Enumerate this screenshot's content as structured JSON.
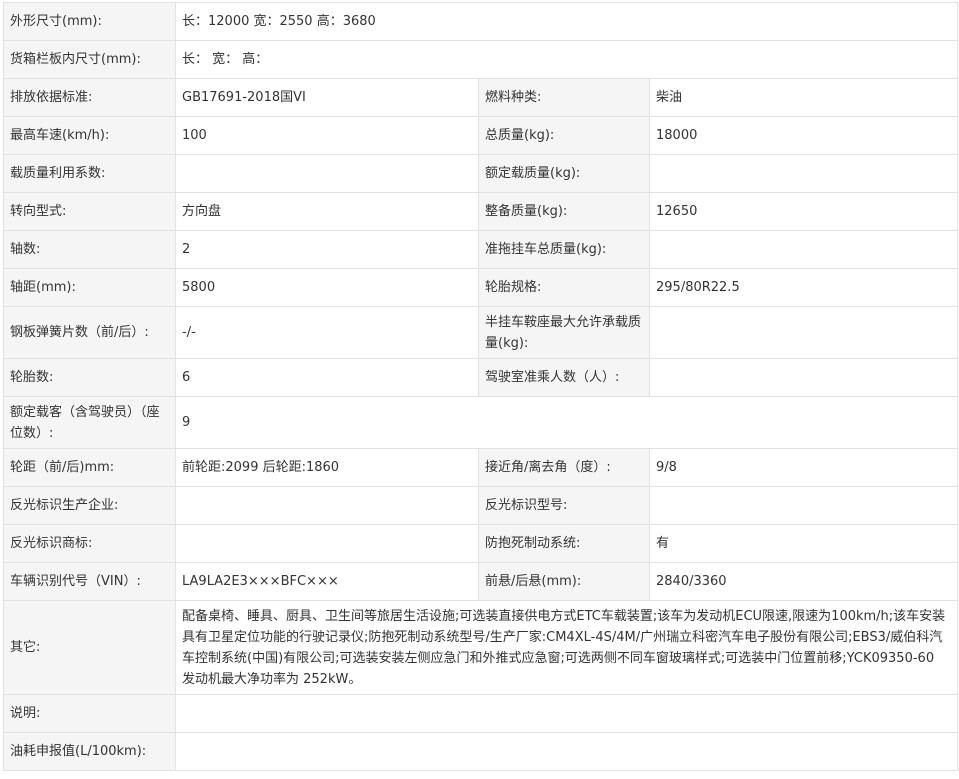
{
  "rows": {
    "dimensions": {
      "label": "外形尺寸(mm):",
      "value": "长：12000 宽：2550 高：3680"
    },
    "cargo_box": {
      "label": "货箱栏板内尺寸(mm):",
      "value": "长： 宽： 高："
    },
    "emission_standard": {
      "label": "排放依据标准:",
      "value": "GB17691-2018国VI"
    },
    "fuel_type": {
      "label": "燃料种类:",
      "value": "柴油"
    },
    "max_speed": {
      "label": "最高车速(km/h):",
      "value": "100"
    },
    "total_mass": {
      "label": "总质量(kg):",
      "value": "18000"
    },
    "load_utilization": {
      "label": "载质量利用系数:",
      "value": ""
    },
    "rated_load": {
      "label": "额定载质量(kg):",
      "value": ""
    },
    "steering": {
      "label": "转向型式:",
      "value": "方向盘"
    },
    "curb_mass": {
      "label": "整备质量(kg):",
      "value": "12650"
    },
    "axles": {
      "label": "轴数:",
      "value": "2"
    },
    "trailer_mass": {
      "label": "准拖挂车总质量(kg):",
      "value": ""
    },
    "wheelbase": {
      "label": "轴距(mm):",
      "value": "5800"
    },
    "tire_spec": {
      "label": "轮胎规格:",
      "value": "295/80R22.5"
    },
    "leaf_springs": {
      "label": "钢板弹簧片数（前/后）:",
      "value": "-/-"
    },
    "saddle_load": {
      "label": "半挂车鞍座最大允许承载质量(kg):",
      "value": ""
    },
    "tire_count": {
      "label": "轮胎数:",
      "value": "6"
    },
    "cab_passengers": {
      "label": "驾驶室准乘人数（人）:",
      "value": ""
    },
    "seats": {
      "label": "额定载客（含驾驶员）（座位数）:",
      "value": "9"
    },
    "track": {
      "label": "轮距（前/后)mm:",
      "value": "前轮距:2099 后轮距:1860"
    },
    "approach_angle": {
      "label": "接近角/离去角（度）:",
      "value": "9/8"
    },
    "reflector_maker": {
      "label": "反光标识生产企业:",
      "value": ""
    },
    "reflector_model": {
      "label": "反光标识型号:",
      "value": ""
    },
    "reflector_brand": {
      "label": "反光标识商标:",
      "value": ""
    },
    "abs": {
      "label": "防抱死制动系统:",
      "value": "有"
    },
    "vin": {
      "label": "车辆识别代号（VIN）:",
      "value": "LA9LA2E3×××BFC×××"
    },
    "overhang": {
      "label": "前悬/后悬(mm):",
      "value": "2840/3360"
    },
    "other": {
      "label": "其它:",
      "value": "配备桌椅、睡具、厨具、卫生间等旅居生活设施;可选装直接供电方式ETC车载装置;该车为发动机ECU限速,限速为100km/h;该车安装具有卫星定位功能的行驶记录仪;防抱死制动系统型号/生产厂家:CM4XL-4S/4M/广州瑞立科密汽车电子股份有限公司;EBS3/威伯科汽车控制系统(中国)有限公司;可选装安装左侧应急门和外推式应急窗;可选两侧不同车窗玻璃样式;可选装中门位置前移;YCK09350-60 发动机最大净功率为 252kW。"
    },
    "notes": {
      "label": "说明:",
      "value": ""
    },
    "fuel_consumption": {
      "label": "油耗申报值(L/100km):",
      "value": ""
    }
  }
}
